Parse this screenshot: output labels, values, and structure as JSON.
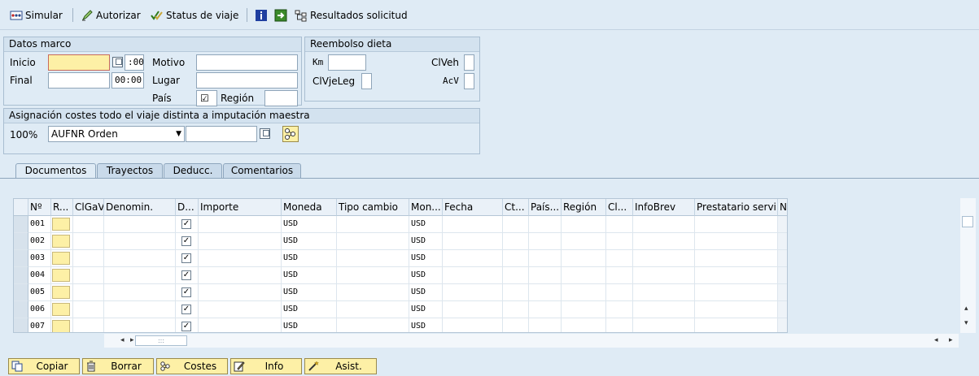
{
  "toolbar": {
    "simular": "Simular",
    "autorizar": "Autorizar",
    "status": "Status de viaje",
    "resultados": "Resultados solicitud"
  },
  "datos_marco": {
    "title": "Datos marco",
    "inicio_label": "Inicio",
    "inicio_date": "",
    "inicio_time": ":00",
    "final_label": "Final",
    "final_date": "",
    "final_time": "00:00",
    "motivo_label": "Motivo",
    "motivo_value": "",
    "lugar_label": "Lugar",
    "lugar_value": "",
    "pais_label": "País",
    "pais_check": "☑",
    "region_label": "Región",
    "region_value": ""
  },
  "reembolso": {
    "title": "Reembolso dieta",
    "km_label": "Km",
    "km_value": "",
    "clveh_label": "ClVeh",
    "clvjeleg_label": "ClVjeLeg",
    "acv_label": "AcV"
  },
  "asignacion": {
    "title": "Asignación costes todo el viaje distinta a imputación maestra",
    "percent": "100%",
    "select_value": "AUFNR Orden",
    "object_value": ""
  },
  "tabs": [
    "Documentos",
    "Trayectos",
    "Deducc.",
    "Comentarios"
  ],
  "table": {
    "headers": [
      "Nº",
      "R...",
      "ClGaV",
      "Denomin.",
      "D...",
      "Importe",
      "Moneda",
      "Tipo cambio",
      "Mon...",
      "Fecha",
      "Ct...",
      "País...",
      "Región",
      "Cl...",
      "InfoBrev",
      "Prestatario servi...",
      "N"
    ],
    "rows": [
      {
        "n": "001",
        "moneda": "USD",
        "mon": "USD",
        "check": "✓"
      },
      {
        "n": "002",
        "moneda": "USD",
        "mon": "USD",
        "check": "✓"
      },
      {
        "n": "003",
        "moneda": "USD",
        "mon": "USD",
        "check": "✓"
      },
      {
        "n": "004",
        "moneda": "USD",
        "mon": "USD",
        "check": "✓"
      },
      {
        "n": "005",
        "moneda": "USD",
        "mon": "USD",
        "check": "✓"
      },
      {
        "n": "006",
        "moneda": "USD",
        "mon": "USD",
        "check": "✓"
      },
      {
        "n": "007",
        "moneda": "USD",
        "mon": "USD",
        "check": "✓"
      }
    ]
  },
  "scroll": {
    "left": "◂",
    "right": "▸",
    "up": "▴",
    "down": "▾",
    "grip": ":::"
  },
  "buttons": {
    "copiar": "Copiar",
    "borrar": "Borrar",
    "costes": "Costes",
    "info": "Info",
    "asist": "Asist."
  },
  "colors": {
    "background": "#dfebf5",
    "field_required": "#fdf0a6",
    "border": "#a9bed1"
  }
}
